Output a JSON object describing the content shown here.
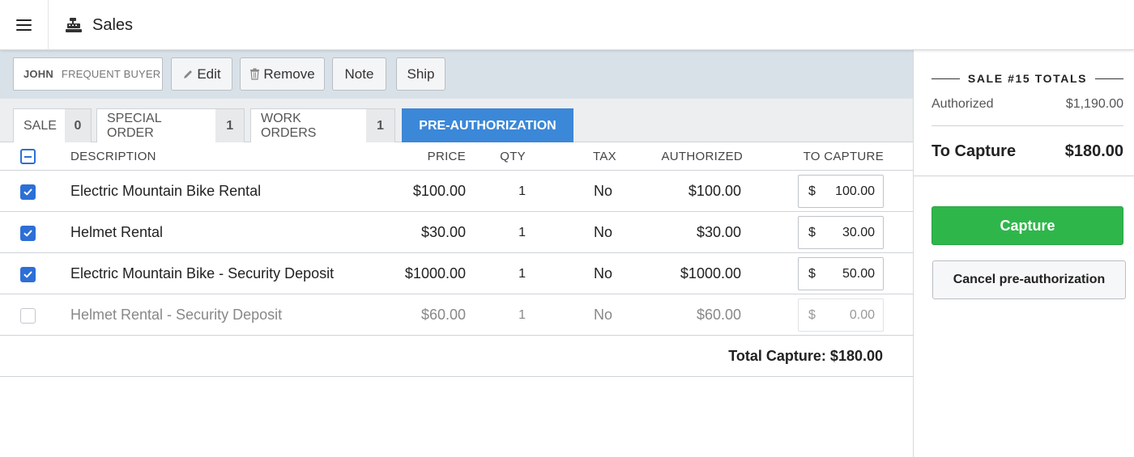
{
  "app": {
    "title": "Sales"
  },
  "customer": {
    "name": "JOHN",
    "type": "FREQUENT BUYER"
  },
  "actions": {
    "edit": "Edit",
    "remove": "Remove",
    "note": "Note",
    "ship": "Ship"
  },
  "tabs": [
    {
      "label": "SALE",
      "count": "0"
    },
    {
      "label": "SPECIAL ORDER",
      "count": "1"
    },
    {
      "label": "WORK ORDERS",
      "count": "1"
    },
    {
      "label": "PRE-AUTHORIZATION"
    }
  ],
  "table": {
    "headers": {
      "description": "DESCRIPTION",
      "price": "PRICE",
      "qty": "QTY",
      "tax": "TAX",
      "authorized": "AUTHORIZED",
      "to_capture": "TO CAPTURE"
    },
    "rows": [
      {
        "checked": true,
        "description": "Electric Mountain Bike Rental",
        "price": "$100.00",
        "qty": "1",
        "tax": "No",
        "authorized": "$100.00",
        "currency": "$",
        "capture": "100.00"
      },
      {
        "checked": true,
        "description": "Helmet Rental",
        "price": "$30.00",
        "qty": "1",
        "tax": "No",
        "authorized": "$30.00",
        "currency": "$",
        "capture": "30.00"
      },
      {
        "checked": true,
        "description": "Electric Mountain Bike - Security Deposit",
        "price": "$1000.00",
        "qty": "1",
        "tax": "No",
        "authorized": "$1000.00",
        "currency": "$",
        "capture": "50.00"
      },
      {
        "checked": false,
        "description": "Helmet Rental - Security Deposit",
        "price": "$60.00",
        "qty": "1",
        "tax": "No",
        "authorized": "$60.00",
        "currency": "$",
        "capture": "0.00"
      }
    ],
    "total_capture": "Total Capture: $180.00"
  },
  "totals": {
    "heading": "SALE #15 TOTALS",
    "authorized_label": "Authorized",
    "authorized_value": "$1,190.00",
    "to_capture_label": "To Capture",
    "to_capture_value": "$180.00"
  },
  "buttons": {
    "capture": "Capture",
    "cancel": "Cancel pre-authorization"
  },
  "colors": {
    "accent": "#3b87d8",
    "checkbox": "#2d6fd6",
    "capture_button": "#2fb64b"
  }
}
